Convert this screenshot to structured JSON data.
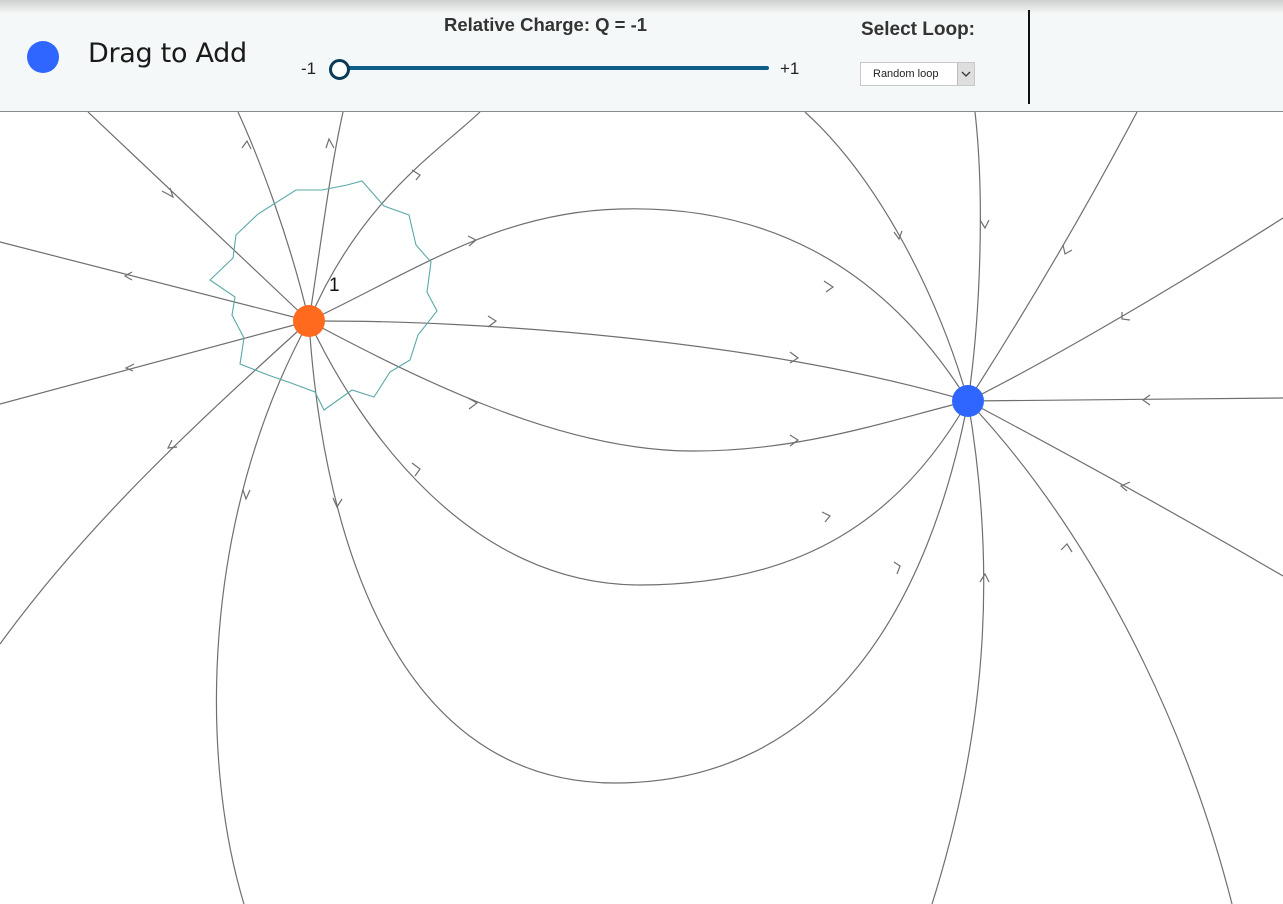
{
  "toolbar": {
    "add_label": "Drag to Add",
    "charge_title": "Relative Charge: Q = -1",
    "slider": {
      "min_label": "-1",
      "max_label": "+1",
      "min": -1,
      "max": 1,
      "value": -1
    },
    "loop_title": "Select Loop:",
    "loop_select": {
      "value": "Random loop"
    }
  },
  "canvas": {
    "loop_label": "1",
    "colors": {
      "negative_charge": "#2f66ff",
      "positive_charge": "#ff6a1f",
      "field_line": "#6f6f6f",
      "loop": "#5aa8a8",
      "slider_track": "#0d5f8a"
    }
  }
}
